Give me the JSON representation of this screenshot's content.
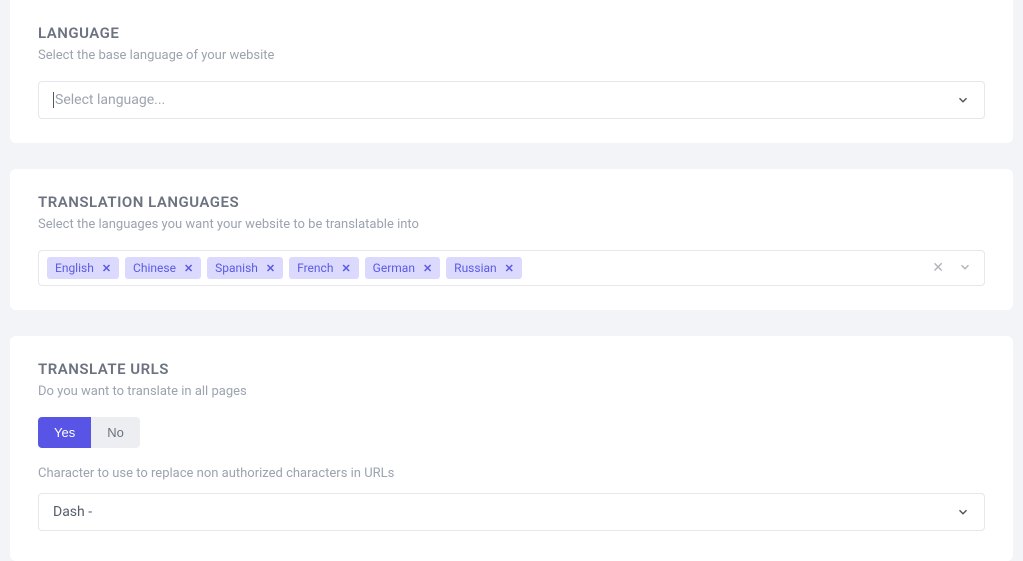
{
  "language": {
    "title": "LANGUAGE",
    "subtitle": "Select the base language of your website",
    "placeholder": "Select language..."
  },
  "translation": {
    "title": "TRANSLATION LANGUAGES",
    "subtitle": "Select the languages you want your website to be translatable into",
    "chips": [
      "English",
      "Chinese",
      "Spanish",
      "French",
      "German",
      "Russian"
    ]
  },
  "urls": {
    "title": "TRANSLATE URLS",
    "subtitle": "Do you want to translate in all pages",
    "yes": "Yes",
    "no": "No",
    "charLabel": "Character to use to replace non authorized characters in URLs",
    "charValue": "Dash -"
  }
}
